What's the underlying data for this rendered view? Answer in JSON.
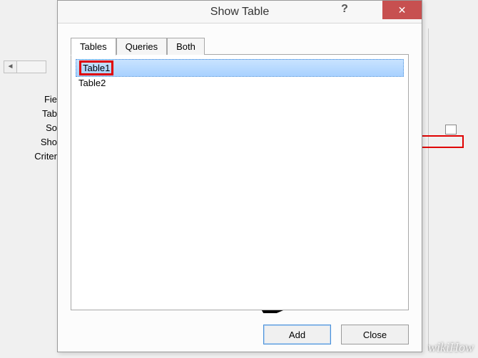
{
  "dialog": {
    "title": "Show Table",
    "help_symbol": "?",
    "close_symbol": "✕",
    "tabs": {
      "tables": "Tables",
      "queries": "Queries",
      "both": "Both"
    },
    "list": {
      "item1": "Table1",
      "item2": "Table2"
    },
    "buttons": {
      "add": "Add",
      "close": "Close"
    }
  },
  "background": {
    "rows": {
      "r1": "Fie",
      "r2": "Tab",
      "r3": "So",
      "r4": "Sho",
      "r5": "Criter"
    },
    "scroll_left": "◄"
  },
  "watermark": "wikiHow"
}
